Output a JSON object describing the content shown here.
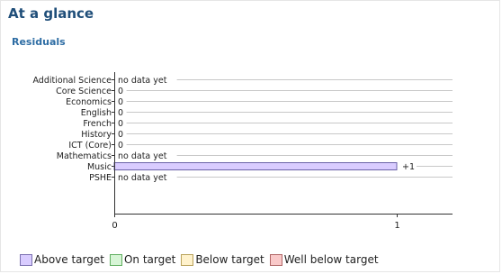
{
  "header": {
    "title": "At a glance",
    "subtitle": "Residuals"
  },
  "chart_data": {
    "type": "bar",
    "orientation": "horizontal",
    "categories": [
      "Additional Science",
      "Core Science",
      "Economics",
      "English",
      "French",
      "History",
      "ICT (Core)",
      "Mathematics",
      "Music",
      "PSHE"
    ],
    "values": [
      null,
      0,
      0,
      0,
      0,
      0,
      0,
      null,
      1,
      null
    ],
    "data_labels": [
      "no data yet",
      "0",
      "0",
      "0",
      "0",
      "0",
      "0",
      "no data yet",
      "+1",
      "no data yet"
    ],
    "x_ticks": [
      "0",
      "1"
    ],
    "xlim": [
      0,
      1.2
    ],
    "bar_status": [
      "",
      "",
      "",
      "",
      "",
      "",
      "",
      "",
      "above",
      ""
    ],
    "grid": "horizontal",
    "legend_position": "bottom-left"
  },
  "legend": [
    {
      "label": "Above target",
      "color": "#d9ccff",
      "border": "#7a6fb0"
    },
    {
      "label": "On target",
      "color": "#d7f5d6",
      "border": "#5fae5f"
    },
    {
      "label": "Below target",
      "color": "#fff2cc",
      "border": "#b9a25a"
    },
    {
      "label": "Well below target",
      "color": "#f9c9c9",
      "border": "#b06666"
    }
  ],
  "colors": {
    "above": "#d9ccff",
    "above_border": "#6a62a8",
    "gridline": "#c8c8c8",
    "axis": "#333333"
  }
}
